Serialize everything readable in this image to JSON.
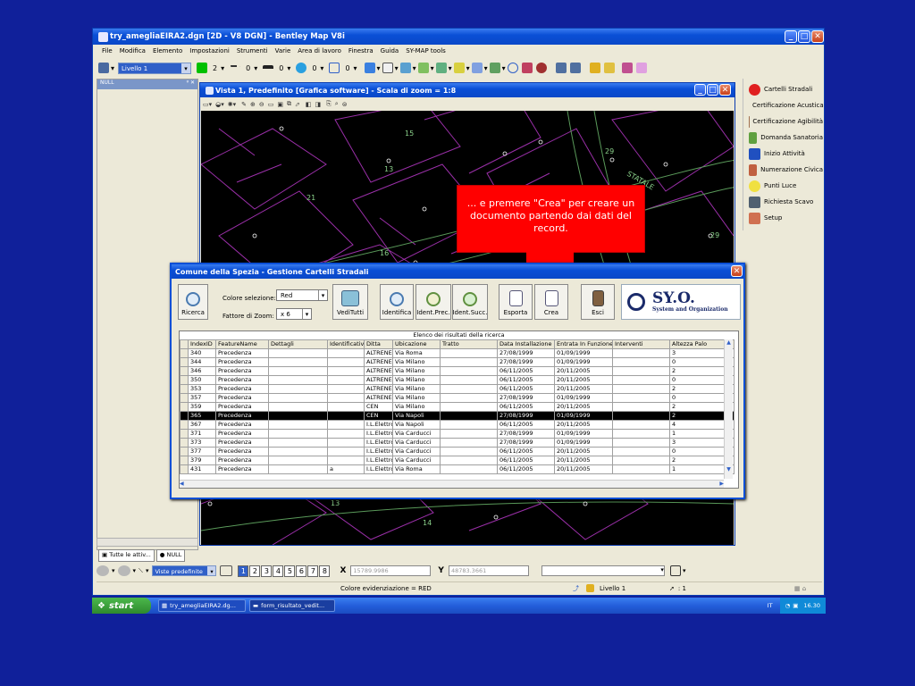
{
  "main_window": {
    "title": "try_amegliaEIRA2.dgn [2D - V8 DGN] - Bentley Map V8i",
    "menu": [
      "File",
      "Modifica",
      "Elemento",
      "Impostazioni",
      "Strumenti",
      "Varie",
      "Area di lavoro",
      "Finestra",
      "Guida",
      "SY-MAP tools"
    ],
    "level_select": "Livello 1",
    "color_value": "2",
    "linestyle_value": "0",
    "weight_value": "0",
    "transparency_value": "0",
    "priority_value": "0"
  },
  "left_panel": {
    "title": "NULL",
    "pin": "ᵍ ✕"
  },
  "view_window": {
    "title": "Vista 1, Predefinito [Grafica software] - Scala di zoom = 1:8",
    "map_labels": [
      "15",
      "13",
      "21",
      "16",
      "29",
      "STATALE",
      "29",
      "13",
      "14"
    ]
  },
  "right_panel": {
    "items": [
      "Cartelli Stradali",
      "Certificazione Acustica",
      "Certificazione Agibilità",
      "Domanda Sanatoria",
      "Inizio Attività",
      "Numerazione Civica",
      "Punti Luce",
      "Richiesta Scavo",
      "Setup"
    ]
  },
  "annotation": {
    "text": "... e premere \"Crea\" per creare un documento partendo dai dati del record."
  },
  "dialog": {
    "title": "Comune della Spezia - Gestione Cartelli Stradali",
    "ricerca": "Ricerca",
    "colore_label": "Colore selezione:",
    "colore_value": "Red",
    "fattore_label": "Fattore di Zoom:",
    "fattore_value": "x 6",
    "buttons": [
      "VediTutti",
      "Identifica",
      "Ident.Prec.",
      "Ident.Succ.",
      "Esporta",
      "Crea",
      "Esci"
    ],
    "logo_text": "SY.O.",
    "logo_sub": "System and Organization",
    "grid_caption": "Elenco dei risultati della ricerca",
    "columns": [
      "IndexID",
      "FeatureName",
      "Dettagli",
      "Identificativo",
      "Ditta",
      "Ubicazione",
      "Tratto",
      "Data Installazione",
      "Entrata In Funzione",
      "Interventi",
      "Altezza Palo"
    ],
    "rows": [
      [
        "340",
        "Precedenza",
        "",
        "",
        "ALTRENER",
        "Via Roma",
        "",
        "27/08/1999",
        "01/09/1999",
        "",
        "3"
      ],
      [
        "344",
        "Precedenza",
        "",
        "",
        "ALTRENER",
        "Via Milano",
        "",
        "27/08/1999",
        "01/09/1999",
        "",
        "0"
      ],
      [
        "346",
        "Precedenza",
        "",
        "",
        "ALTRENER",
        "Via Milano",
        "",
        "06/11/2005",
        "20/11/2005",
        "",
        "2"
      ],
      [
        "350",
        "Precedenza",
        "",
        "",
        "ALTRENER",
        "Via Milano",
        "",
        "06/11/2005",
        "20/11/2005",
        "",
        "0"
      ],
      [
        "353",
        "Precedenza",
        "",
        "",
        "ALTRENER",
        "Via Milano",
        "",
        "06/11/2005",
        "20/11/2005",
        "",
        "2"
      ],
      [
        "357",
        "Precedenza",
        "",
        "",
        "ALTRENER",
        "Via Milano",
        "",
        "27/08/1999",
        "01/09/1999",
        "",
        "0"
      ],
      [
        "359",
        "Precedenza",
        "",
        "",
        "CEN",
        "Via Milano",
        "",
        "06/11/2005",
        "20/11/2005",
        "",
        "2"
      ],
      [
        "365",
        "Precedenza",
        "",
        "",
        "CEN",
        "Via Napoli",
        "",
        "27/08/1999",
        "01/09/1999",
        "",
        "2"
      ],
      [
        "367",
        "Precedenza",
        "",
        "",
        "I.L.Elettro",
        "Via Napoli",
        "",
        "06/11/2005",
        "20/11/2005",
        "",
        "4"
      ],
      [
        "371",
        "Precedenza",
        "",
        "",
        "I.L.Elettro",
        "Via Carducci",
        "",
        "27/08/1999",
        "01/09/1999",
        "",
        "1"
      ],
      [
        "373",
        "Precedenza",
        "",
        "",
        "I.L.Elettro",
        "Via Carducci",
        "",
        "27/08/1999",
        "01/09/1999",
        "",
        "3"
      ],
      [
        "377",
        "Precedenza",
        "",
        "",
        "I.L.Elettro",
        "Via Carducci",
        "",
        "06/11/2005",
        "20/11/2005",
        "",
        "0"
      ],
      [
        "379",
        "Precedenza",
        "",
        "",
        "I.L.Elettro",
        "Via Carducci",
        "",
        "06/11/2005",
        "20/11/2005",
        "",
        "2"
      ],
      [
        "431",
        "Precedenza",
        "",
        "a",
        "I.L.Elettro",
        "Via Roma",
        "",
        "06/11/2005",
        "20/11/2005",
        "",
        "1"
      ]
    ],
    "selected_index": 7
  },
  "bottom_tabs": [
    "Tutte le attiv...",
    "NULL"
  ],
  "view_bar": {
    "view_select": "Viste predefinite",
    "views": [
      "1",
      "2",
      "3",
      "4",
      "5",
      "6",
      "7",
      "8"
    ],
    "x_label": "X",
    "x_value": "15789.9986",
    "y_label": "Y",
    "y_value": "48783.3661"
  },
  "status_bar": {
    "message": "Colore evidenziazione = RED",
    "level": "Livello 1",
    "selection": ": 1"
  },
  "taskbar": {
    "start": "start",
    "tasks": [
      "try_amegliaEIRA2.dg...",
      "form_risultato_vedit..."
    ],
    "lang": "IT",
    "clock": "16.30"
  }
}
